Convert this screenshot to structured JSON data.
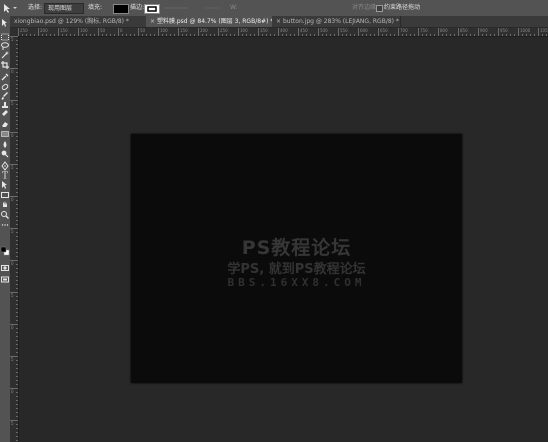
{
  "options_bar": {
    "select_label": "选择:",
    "select_value": "现用图层",
    "fill_label": "填充:",
    "stroke_label": "描边:",
    "w_label": "W:",
    "align_edges": "对齐边缘",
    "constrain_path": "约束路径拖动",
    "fill_color": "#000000",
    "stroke_color": "#ffffff"
  },
  "tabs": [
    {
      "label": "xiongbiao.psd @ 129% (胸标, RGB/8) *",
      "active": false
    },
    {
      "label": "塑料膜.psd @ 84.7% (图层 3, RGB/8#) *",
      "active": true
    },
    {
      "label": "button.jpg @ 283% (LEJIANG, RGB/8) *",
      "active": false
    }
  ],
  "ruler_h_labels": [
    "250",
    "200",
    "150",
    "100",
    "50",
    "0",
    "50",
    "100",
    "150",
    "200",
    "250",
    "300",
    "350",
    "400",
    "450",
    "500",
    "550",
    "600",
    "650",
    "700",
    "750",
    "800",
    "850",
    "900",
    "950",
    "1000",
    "1050",
    "1100"
  ],
  "ruler_v_labels": [
    "5",
    "0",
    "5",
    "0",
    "5",
    "0",
    "5",
    "0",
    "5",
    "0",
    "5",
    "0",
    "5"
  ],
  "tools": [
    "move-tool",
    "marquee-tool",
    "lasso-tool",
    "magic-wand-tool",
    "crop-tool",
    "eyedropper-tool",
    "spot-healing-tool",
    "brush-tool",
    "clone-stamp-tool",
    "history-brush-tool",
    "eraser-tool",
    "gradient-tool",
    "blur-tool",
    "dodge-tool",
    "pen-tool",
    "type-tool",
    "path-selection-tool",
    "rectangle-tool",
    "hand-tool",
    "zoom-tool",
    "edit-toolbar",
    "color-swatches",
    "quick-mask",
    "screen-mode"
  ],
  "watermark": {
    "line1": "PS教程论坛",
    "line2": "学PS, 就到PS教程论坛",
    "line3": "BBS.16XX8.COM"
  }
}
